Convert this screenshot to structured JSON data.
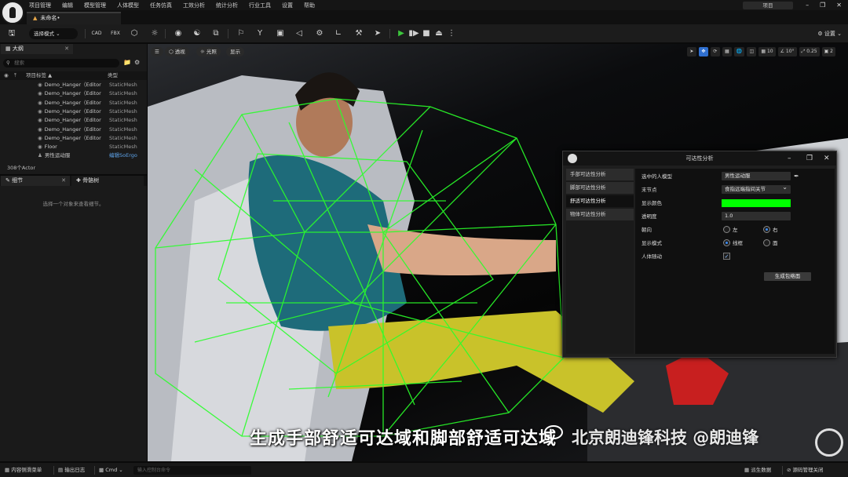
{
  "menubar": {
    "items": [
      "项目管理",
      "编辑",
      "模型管理",
      "人体模型",
      "任务仿真",
      "工效分析",
      "统计分析",
      "行业工具",
      "设置",
      "帮助"
    ],
    "project_button": "项目"
  },
  "document_tab": {
    "label": "未命名•"
  },
  "toolbar": {
    "mode_label": "选择模式",
    "settings_label": "设置",
    "cad_label": "CAD",
    "fbx_label": "FBX"
  },
  "outliner": {
    "tab_label": "大纲",
    "search_placeholder": "搜索",
    "col_label": "项目标签",
    "col_type": "类型",
    "rows": [
      {
        "name": "Demo_Hanger（Editor",
        "type": "StaticMesh"
      },
      {
        "name": "Demo_Hanger（Editor",
        "type": "StaticMesh"
      },
      {
        "name": "Demo_Hanger（Editor",
        "type": "StaticMesh"
      },
      {
        "name": "Demo_Hanger（Editor",
        "type": "StaticMesh"
      },
      {
        "name": "Demo_Hanger（Editor",
        "type": "StaticMesh"
      },
      {
        "name": "Demo_Hanger（Editor",
        "type": "StaticMesh"
      },
      {
        "name": "Demo_Hanger（Editor",
        "type": "StaticMesh"
      },
      {
        "name": "Floor",
        "type": "StaticMesh"
      },
      {
        "name": "男性运动服",
        "type": "编辑SoErgo"
      }
    ],
    "actor_count": "308个Actor"
  },
  "details": {
    "tab1_label": "细节",
    "tab2_label": "骨骼树",
    "hint": "选择一个对象来查看细节。"
  },
  "viewport": {
    "btn_perspective": "透视",
    "btn_lit": "光照",
    "btn_show": "显示",
    "grid_value": "10",
    "angle_value": "10°",
    "scale_value": "0.25",
    "camera_value": "2",
    "subtitle": "生成手部舒适可达域和脚部舒适可达域",
    "watermark": "北京朗迪锋科技 @朗迪锋"
  },
  "analysis_window": {
    "title": "可达性分析",
    "side_items": [
      "手部可达性分析",
      "脚部可达性分析",
      "舒适可达性分析",
      "物体可达性分析"
    ],
    "active_index": 2,
    "fields": {
      "model_label": "选中的人模型",
      "model_value": "男性运动服",
      "end_label": "末节点",
      "end_value": "食指远端指间关节",
      "color_label": "显示颜色",
      "color_value": "#00ff00",
      "opacity_label": "透明度",
      "opacity_value": "1.0",
      "side_label": "朝向",
      "side_left": "左",
      "side_right": "右",
      "side_selected": "右",
      "display_label": "显示模式",
      "display_wire": "线框",
      "display_face": "面",
      "display_selected": "线框",
      "follow_label": "人体随动",
      "follow_checked": true
    },
    "generate_button": "生成包络面"
  },
  "statusbar": {
    "content_drawer": "内容侧滑菜单",
    "output_log": "输出日志",
    "cmd_label": "Cmd",
    "cmd_placeholder": "输入控制台命令",
    "derived_data": "派生数据",
    "source_control": "源码管理关闭"
  },
  "colors": {
    "accent_blue": "#2f6fcf",
    "play_green": "#3cc63c",
    "reach_green": "#00ff00",
    "link_blue": "#5da2e8"
  }
}
